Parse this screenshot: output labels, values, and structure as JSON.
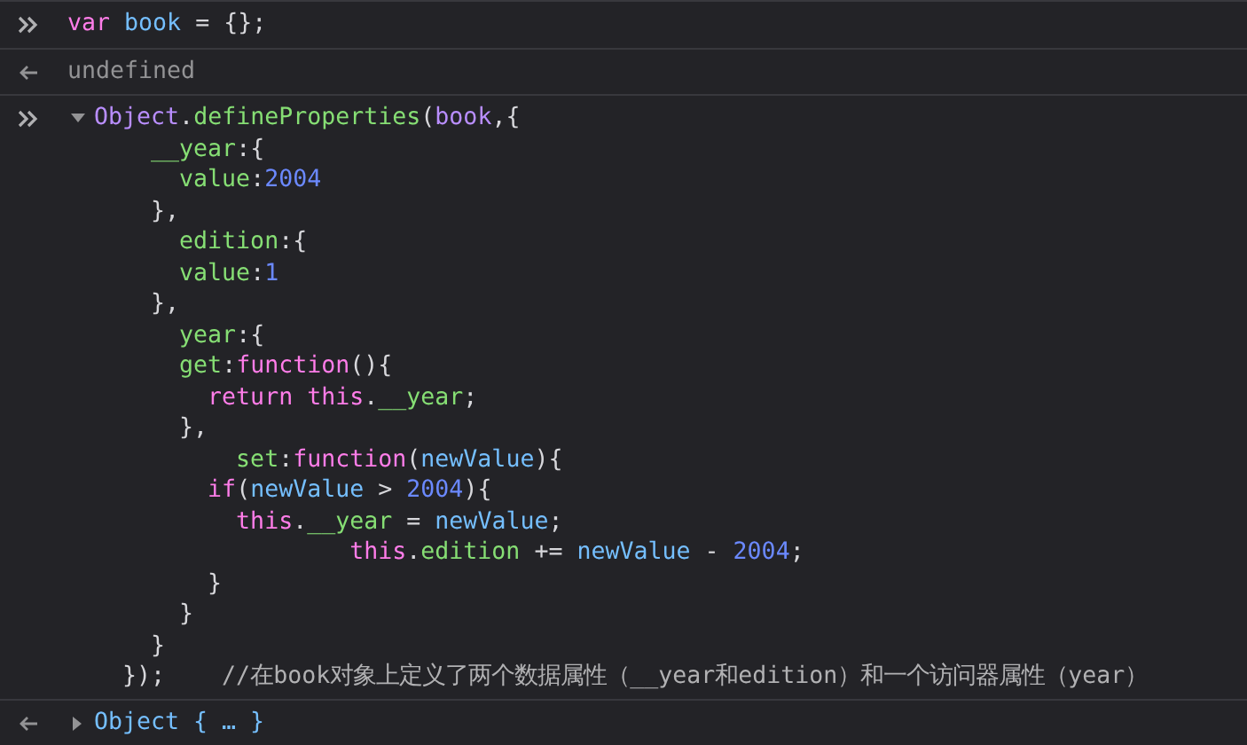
{
  "entries": [
    {
      "kind": "input",
      "lines": [
        [
          {
            "text": "var",
            "kind": "kw"
          },
          {
            "text": " book",
            "kind": "id"
          },
          {
            "text": " = {};",
            "kind": "punc"
          }
        ]
      ]
    },
    {
      "kind": "output",
      "lines": [
        [
          {
            "text": "undefined",
            "kind": "dim"
          }
        ]
      ]
    },
    {
      "kind": "input",
      "expanded": true,
      "lines": [
        [
          {
            "text": "Object",
            "kind": "obj"
          },
          {
            "text": ".",
            "kind": "punc"
          },
          {
            "text": "defineProperties",
            "kind": "prop"
          },
          {
            "text": "(",
            "kind": "punc"
          },
          {
            "text": "book",
            "kind": "obj"
          },
          {
            "text": ",{",
            "kind": "punc"
          }
        ],
        [
          {
            "text": "    __year",
            "kind": "prop"
          },
          {
            "text": ":{",
            "kind": "punc"
          }
        ],
        [
          {
            "text": "      value",
            "kind": "prop"
          },
          {
            "text": ":",
            "kind": "punc"
          },
          {
            "text": "2004",
            "kind": "num"
          }
        ],
        [
          {
            "text": "    },",
            "kind": "punc"
          }
        ],
        [
          {
            "text": "      edition",
            "kind": "prop"
          },
          {
            "text": ":{",
            "kind": "punc"
          }
        ],
        [
          {
            "text": "      value",
            "kind": "prop"
          },
          {
            "text": ":",
            "kind": "punc"
          },
          {
            "text": "1",
            "kind": "num"
          }
        ],
        [
          {
            "text": "    },",
            "kind": "punc"
          }
        ],
        [
          {
            "text": "      year",
            "kind": "prop"
          },
          {
            "text": ":{",
            "kind": "punc"
          }
        ],
        [
          {
            "text": "      get",
            "kind": "prop"
          },
          {
            "text": ":",
            "kind": "punc"
          },
          {
            "text": "function",
            "kind": "kw"
          },
          {
            "text": "(){",
            "kind": "punc"
          }
        ],
        [
          {
            "text": "        return",
            "kind": "kw"
          },
          {
            "text": " this",
            "kind": "kw"
          },
          {
            "text": ".",
            "kind": "punc"
          },
          {
            "text": "__year",
            "kind": "prop"
          },
          {
            "text": ";",
            "kind": "punc"
          }
        ],
        [
          {
            "text": "      },",
            "kind": "punc"
          }
        ],
        [
          {
            "text": "          set",
            "kind": "prop"
          },
          {
            "text": ":",
            "kind": "punc"
          },
          {
            "text": "function",
            "kind": "kw"
          },
          {
            "text": "(",
            "kind": "punc"
          },
          {
            "text": "newValue",
            "kind": "id"
          },
          {
            "text": "){",
            "kind": "punc"
          }
        ],
        [
          {
            "text": "        if",
            "kind": "kw"
          },
          {
            "text": "(",
            "kind": "punc"
          },
          {
            "text": "newValue",
            "kind": "id"
          },
          {
            "text": " > ",
            "kind": "punc"
          },
          {
            "text": "2004",
            "kind": "num"
          },
          {
            "text": "){",
            "kind": "punc"
          }
        ],
        [
          {
            "text": "          this",
            "kind": "kw"
          },
          {
            "text": ".",
            "kind": "punc"
          },
          {
            "text": "__year",
            "kind": "prop"
          },
          {
            "text": " = ",
            "kind": "punc"
          },
          {
            "text": "newValue",
            "kind": "id"
          },
          {
            "text": ";",
            "kind": "punc"
          }
        ],
        [
          {
            "text": "                  this",
            "kind": "kw"
          },
          {
            "text": ".",
            "kind": "punc"
          },
          {
            "text": "edition",
            "kind": "prop"
          },
          {
            "text": " += ",
            "kind": "punc"
          },
          {
            "text": "newValue",
            "kind": "id"
          },
          {
            "text": " - ",
            "kind": "punc"
          },
          {
            "text": "2004",
            "kind": "num"
          },
          {
            "text": ";",
            "kind": "punc"
          }
        ],
        [
          {
            "text": "        }",
            "kind": "punc"
          }
        ],
        [
          {
            "text": "      }",
            "kind": "punc"
          }
        ],
        [
          {
            "text": "    }",
            "kind": "punc"
          }
        ],
        [
          {
            "text": "  });",
            "kind": "punc"
          },
          {
            "text": "    //在book对象上定义了两个数据属性（__year和edition）和一个访问器属性（year）",
            "kind": "cm"
          }
        ]
      ]
    },
    {
      "kind": "output",
      "expanded": false,
      "lines": [
        [
          {
            "text": "Object { … }",
            "kind": "id"
          }
        ]
      ]
    }
  ]
}
